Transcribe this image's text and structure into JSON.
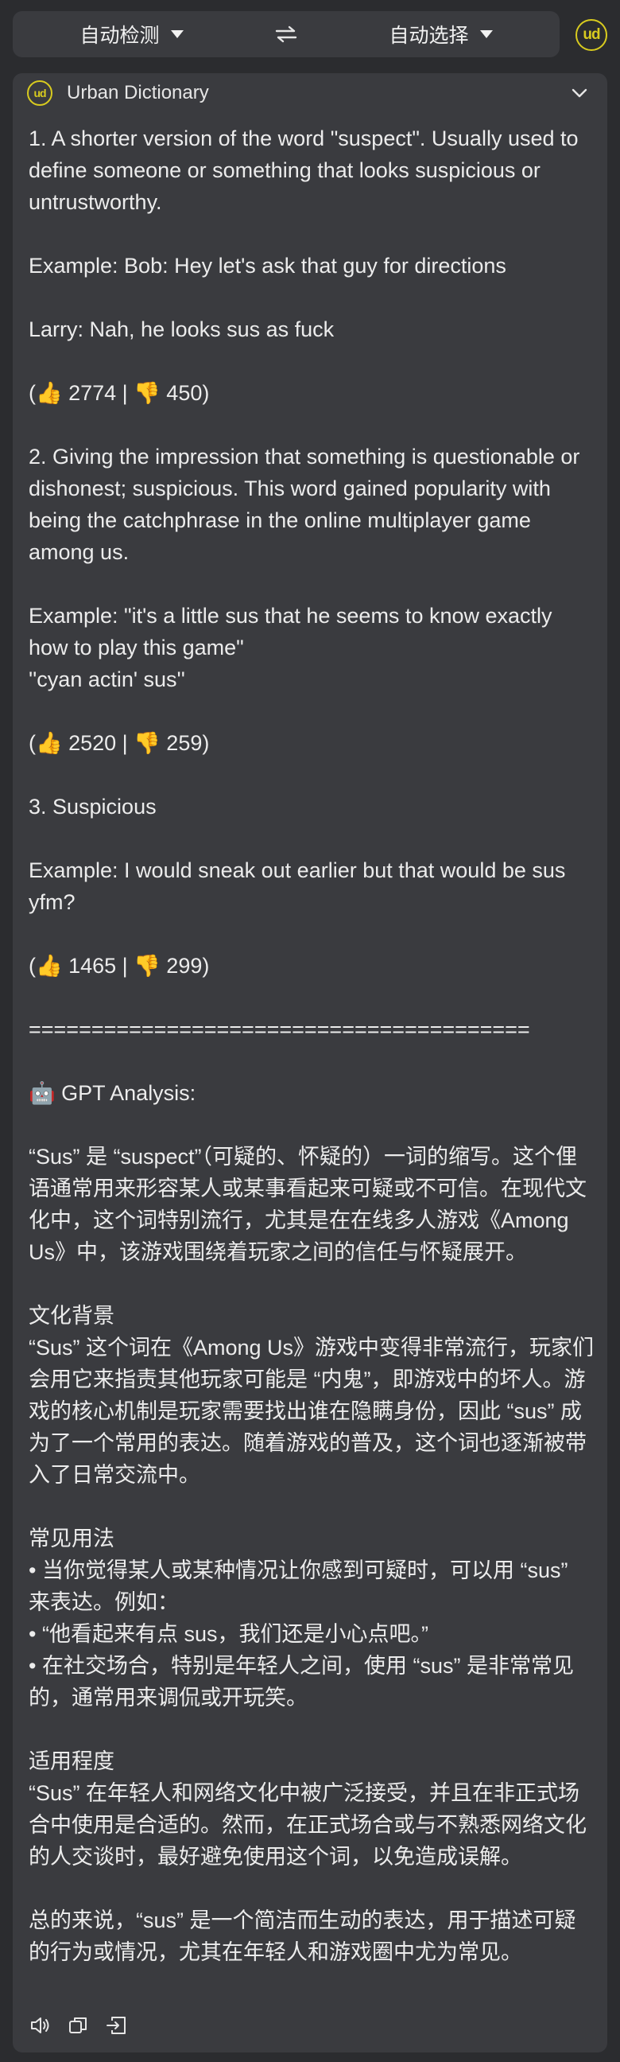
{
  "toolbar": {
    "source_lang": "自动检测",
    "target_lang": "自动选择"
  },
  "logo_text": "ud",
  "card": {
    "title": "Urban Dictionary"
  },
  "lines": [
    "1. A shorter version of the word \"suspect\". Usually used to define someone or something that looks suspicious or untrustworthy.",
    "",
    "Example: Bob: Hey let's ask that guy for directions",
    "",
    "Larry: Nah, he looks sus as fuck",
    "",
    "(👍 2774 | 👎 450)",
    "",
    "2. Giving the impression that something is questionable or dishonest; suspicious. This word gained popularity with being the catchphrase in the online multiplayer game among us.",
    "",
    "Example: \"it's a little sus that he seems to know exactly how to play this game\"",
    "''cyan actin' sus''",
    "",
    "(👍 2520 | 👎 259)",
    "",
    "3. Suspicious",
    "",
    "Example: I would sneak out earlier but that would be sus yfm?",
    "",
    "(👍 1465 | 👎 299)",
    "",
    "========================================",
    "",
    "🤖 GPT Analysis:",
    "",
    "“Sus” 是 “suspect”（可疑的、怀疑的）一词的缩写。这个俚语通常用来形容某人或某事看起来可疑或不可信。在现代文化中，这个词特别流行，尤其是在在线多人游戏《Among Us》中，该游戏围绕着玩家之间的信任与怀疑展开。",
    "",
    "文化背景",
    "“Sus” 这个词在《Among Us》游戏中变得非常流行，玩家们会用它来指责其他玩家可能是 “内鬼”，即游戏中的坏人。游戏的核心机制是玩家需要找出谁在隐瞒身份，因此 “sus” 成为了一个常用的表达。随着游戏的普及，这个词也逐渐被带入了日常交流中。",
    "",
    "常见用法",
    "• 当你觉得某人或某种情况让你感到可疑时，可以用 “sus” 来表达。例如：",
    "• “他看起来有点 sus，我们还是小心点吧。”",
    "• 在社交场合，特别是年轻人之间，使用 “sus” 是非常常见的，通常用来调侃或开玩笑。",
    "",
    "适用程度",
    "“Sus” 在年轻人和网络文化中被广泛接受，并且在非正式场合中使用是合适的。然而，在正式场合或与不熟悉网络文化的人交谈时，最好避免使用这个词，以免造成误解。",
    "",
    "总的来说，“sus” 是一个简洁而生动的表达，用于描述可疑的行为或情况，尤其在年轻人和游戏圈中尤为常见。"
  ],
  "icons": {
    "swap": "swap-arrows-icon",
    "collapse": "chevron-down-icon",
    "speak": "speaker-icon",
    "copy": "copy-icon",
    "insert": "insert-icon"
  },
  "colors": {
    "background": "#2b2c2f",
    "panel": "#3a3b3f",
    "accent": "#d8cb1f",
    "text": "#ececec"
  }
}
